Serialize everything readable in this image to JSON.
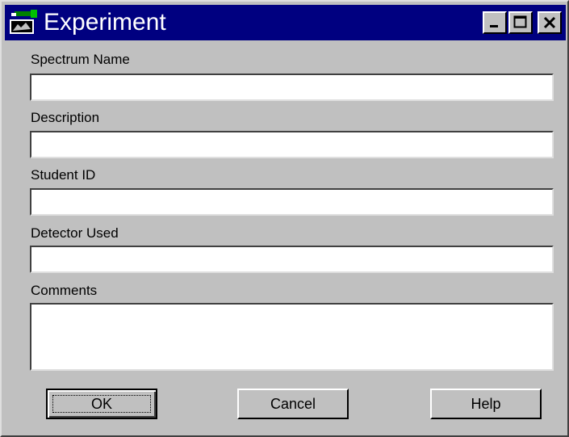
{
  "window": {
    "title": "Experiment",
    "controls": {
      "minimize": "_",
      "maximize": "□",
      "close": "✕"
    }
  },
  "form": {
    "spectrum_name": {
      "label": "Spectrum Name",
      "value": ""
    },
    "description": {
      "label": "Description",
      "value": ""
    },
    "student_id": {
      "label": "Student ID",
      "value": ""
    },
    "detector_used": {
      "label": "Detector Used",
      "value": ""
    },
    "comments": {
      "label": "Comments",
      "value": ""
    }
  },
  "buttons": {
    "ok": "OK",
    "cancel": "Cancel",
    "help": "Help"
  },
  "colors": {
    "titlebar": "#000080",
    "face": "#c0c0c0",
    "field": "#ffffff"
  },
  "icons": {
    "app": "experiment-app-icon"
  }
}
